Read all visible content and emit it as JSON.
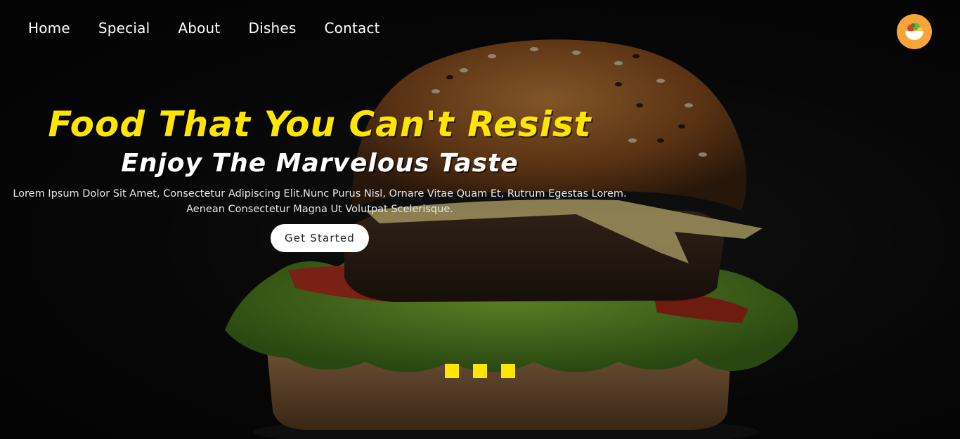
{
  "nav": {
    "items": [
      "Home",
      "Special",
      "About",
      "Dishes",
      "Contact"
    ]
  },
  "logo": {
    "icon": "salad-bowl-icon",
    "color": "#f7a43a"
  },
  "hero": {
    "headline": "Food That You Can't Resist",
    "subheadline": "Enjoy The Marvelous Taste",
    "description_line1": "Lorem Ipsum Dolor Sit Amet, Consectetur Adipiscing Elit.Nunc Purus Nisl, Ornare Vitae Quam Et, Rutrum Egestas Lorem.",
    "description_line2": "Aenean Consectetur Magna Ut Volutpat Scelerisque.",
    "cta_label": "Get Started",
    "headline_color": "#ffe600"
  },
  "slider": {
    "dot_count": 3,
    "dot_color": "#ffe600"
  }
}
